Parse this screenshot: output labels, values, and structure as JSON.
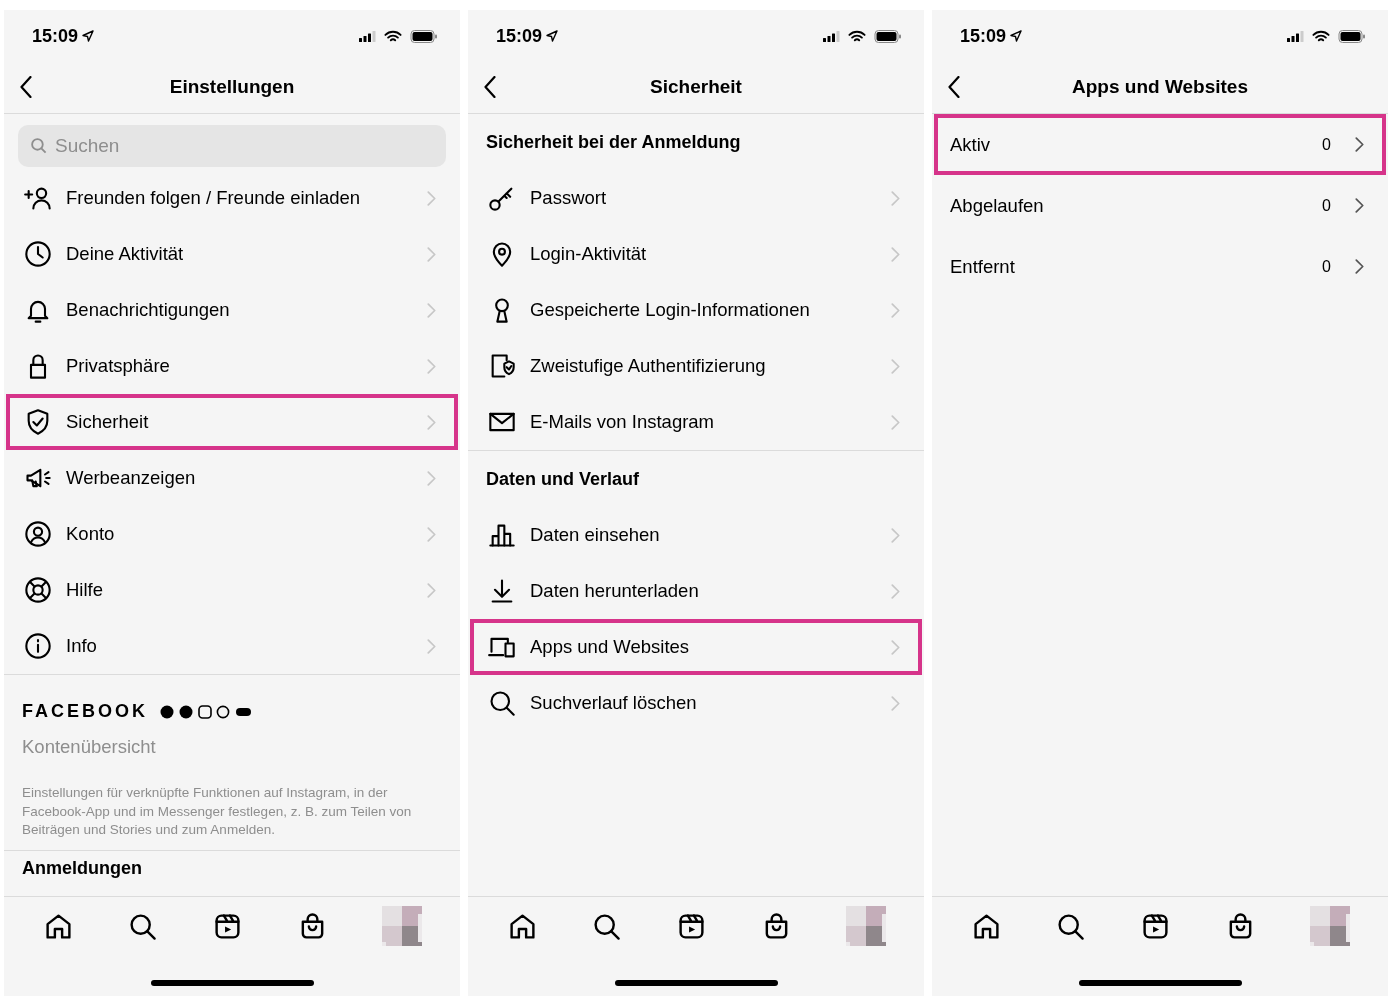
{
  "screens": [
    {
      "time": "15:09",
      "title": "Einstellungen",
      "search": {
        "placeholder": "Suchen"
      },
      "sections": [
        {
          "items": [
            {
              "label": "Freunden folgen / Freunde einladen",
              "highlighted": false
            },
            {
              "label": "Deine Aktivität",
              "highlighted": false
            },
            {
              "label": "Benachrichtigungen",
              "highlighted": false
            },
            {
              "label": "Privatsphäre",
              "highlighted": false
            },
            {
              "label": "Sicherheit",
              "highlighted": true
            },
            {
              "label": "Werbeanzeigen",
              "highlighted": false
            },
            {
              "label": "Konto",
              "highlighted": false
            },
            {
              "label": "Hilfe",
              "highlighted": false
            },
            {
              "label": "Info",
              "highlighted": false
            }
          ]
        }
      ],
      "brand": {
        "name": "FACEBOOK",
        "link": "Kontenübersicht",
        "description": "Einstellungen für verknüpfte Funktionen auf Instagram, in der Facebook-App und im Messenger festlegen, z. B. zum Teilen von Beiträgen und Stories und zum Anmelden."
      },
      "next_heading": "Anmeldungen"
    },
    {
      "time": "15:09",
      "title": "Sicherheit",
      "sections": [
        {
          "heading": "Sicherheit bei der Anmeldung",
          "items": [
            {
              "label": "Passwort",
              "highlighted": false
            },
            {
              "label": "Login-Aktivität",
              "highlighted": false
            },
            {
              "label": "Gespeicherte Login-Informationen",
              "highlighted": false
            },
            {
              "label": "Zweistufige Authentifizierung",
              "highlighted": false
            },
            {
              "label": "E-Mails von Instagram",
              "highlighted": false
            }
          ]
        },
        {
          "heading": "Daten und Verlauf",
          "items": [
            {
              "label": "Daten einsehen",
              "highlighted": false
            },
            {
              "label": "Daten herunterladen",
              "highlighted": false
            },
            {
              "label": "Apps und Websites",
              "highlighted": true
            },
            {
              "label": "Suchverlauf löschen",
              "highlighted": false
            }
          ]
        }
      ]
    },
    {
      "time": "15:09",
      "title": "Apps und Websites",
      "sections": [
        {
          "items": [
            {
              "label": "Aktiv",
              "count": "0",
              "highlighted": true
            },
            {
              "label": "Abgelaufen",
              "count": "0",
              "highlighted": false
            },
            {
              "label": "Entfernt",
              "count": "0",
              "highlighted": false
            }
          ]
        }
      ]
    }
  ]
}
